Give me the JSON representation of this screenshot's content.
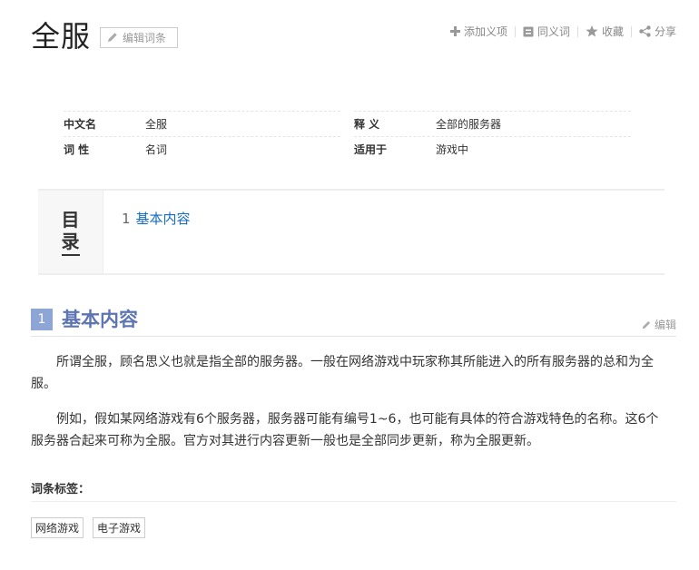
{
  "header": {
    "title": "全服",
    "edit_entry_label": "编辑词条"
  },
  "actions": {
    "add_meaning": "添加义项",
    "synonym": "同义词",
    "favorite": "收藏",
    "share": "分享"
  },
  "basic_info": {
    "left": [
      {
        "label": "中文名",
        "value": "全服"
      },
      {
        "label": "词 性",
        "value": "名词"
      }
    ],
    "right": [
      {
        "label": "释 义",
        "value": "全部的服务器"
      },
      {
        "label": "适用于",
        "value": "游戏中"
      }
    ]
  },
  "toc": {
    "title_char_1": "目",
    "title_char_2": "录",
    "items": [
      {
        "num": "1",
        "label": "基本内容"
      }
    ]
  },
  "section": {
    "num": "1",
    "title": "基本内容",
    "edit_label": "编辑",
    "paragraphs": [
      "所谓全服，顾名思义也就是指全部的服务器。一般在网络游戏中玩家称其所能进入的所有服务器的总和为全服。",
      "例如，假如某网络游戏有6个服务器，服务器可能有编号1~6，也可能有具体的符合游戏特色的名称。这6个服务器合起来可称为全服。官方对其进行内容更新一般也是全部同步更新，称为全服更新。"
    ]
  },
  "tags": {
    "heading": "词条标签：",
    "items": [
      "网络游戏",
      "电子游戏"
    ]
  },
  "colors": {
    "link": "#136ec2",
    "section_accent": "#5e75b3",
    "section_num_bg": "#8ea6d5"
  }
}
